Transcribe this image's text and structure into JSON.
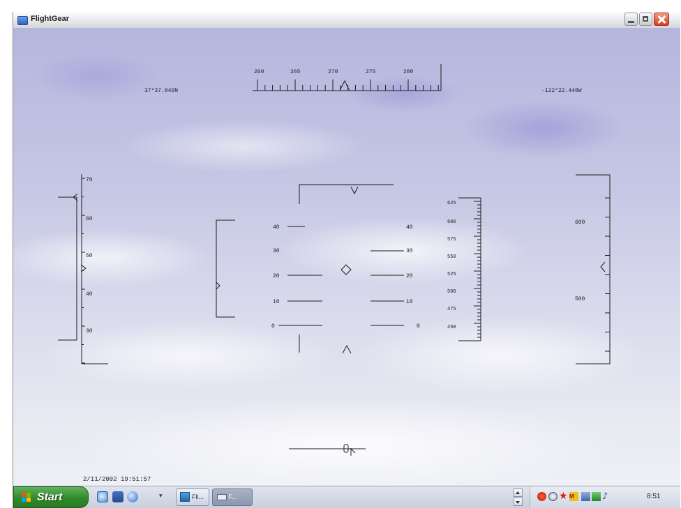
{
  "window": {
    "title": "FlightGear"
  },
  "hud": {
    "latitude": "37°37.849N",
    "longitude": "-122°22.440W",
    "timestamp": "2/11/2002 19:51:57",
    "heading_scale": [
      "260",
      "265",
      "270",
      "275",
      "280"
    ],
    "left_scale": [
      "70",
      "60",
      "50",
      "40",
      "30"
    ],
    "pitch_left": [
      "40",
      "30",
      "20",
      "10",
      "0"
    ],
    "pitch_right": [
      "40",
      "30",
      "20",
      "10",
      "0"
    ],
    "speed_tape": [
      "625",
      "600",
      "575",
      "550",
      "525",
      "500",
      "475",
      "450"
    ],
    "altitude_scale": [
      "600",
      "500"
    ]
  },
  "taskbar": {
    "start_label": "Start",
    "task_1_label": "Fli...",
    "task_2_label": "F...",
    "clock": "8:51"
  },
  "icons": {
    "app": "flightgear-icon",
    "start": "windows-flag-icon",
    "quick_launch": [
      "browser-icon",
      "email-icon",
      "media-player-icon"
    ],
    "tray": [
      "antivirus-icon",
      "network-icon",
      "alert-icon",
      "messenger-icon",
      "display-icon",
      "security-icon",
      "volume-icon"
    ]
  }
}
